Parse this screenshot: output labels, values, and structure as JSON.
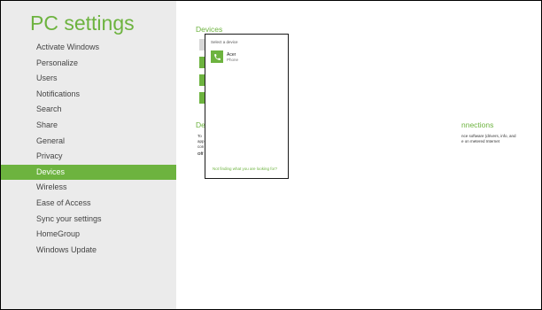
{
  "app": {
    "title": "PC settings"
  },
  "nav": {
    "items": [
      {
        "label": "Activate Windows"
      },
      {
        "label": "Personalize"
      },
      {
        "label": "Users"
      },
      {
        "label": "Notifications"
      },
      {
        "label": "Search"
      },
      {
        "label": "Share"
      },
      {
        "label": "General"
      },
      {
        "label": "Privacy"
      },
      {
        "label": "Devices",
        "selected": true
      },
      {
        "label": "Wireless"
      },
      {
        "label": "Ease of Access"
      },
      {
        "label": "Sync your settings"
      },
      {
        "label": "HomeGroup"
      },
      {
        "label": "Windows Update"
      }
    ]
  },
  "main": {
    "section_title": "Devices",
    "section2_title_left": "De",
    "section2_title_right": "nnections",
    "stub_lines": [
      "To",
      "app",
      "con",
      "Off"
    ],
    "desc_lines": [
      "nce software (drivers, info, and",
      "e on metered Internet"
    ]
  },
  "flyout": {
    "header": "Select a device",
    "device": {
      "name": "Acer",
      "type": "Phone",
      "icon": "phone-icon"
    },
    "link": "Not finding what you are looking for?"
  },
  "colors": {
    "accent": "#6db33f",
    "sidebar_bg": "#ebebeb",
    "text": "#444444"
  }
}
